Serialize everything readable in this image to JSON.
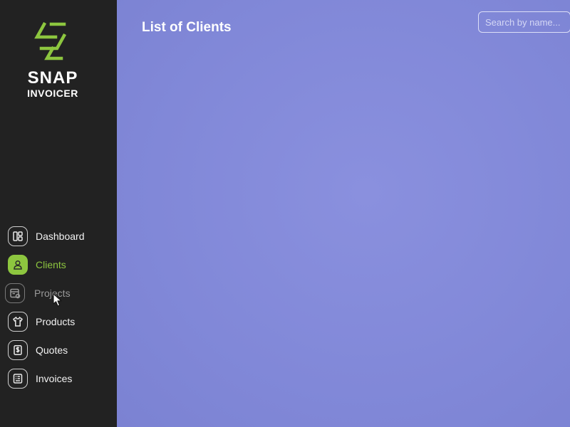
{
  "app": {
    "logo_line1": "SNAP",
    "logo_line2": "INVOICER",
    "accent_color": "#8dc63f",
    "sidebar_color": "#222222",
    "main_color": "#8188d8"
  },
  "header": {
    "title": "List of Clients",
    "search_placeholder": "Search by name..."
  },
  "sidebar": {
    "items": [
      {
        "label": "Dashboard",
        "icon": "dashboard-grid-icon",
        "state": "normal"
      },
      {
        "label": "Clients",
        "icon": "user-icon",
        "state": "active"
      },
      {
        "label": "Projects",
        "icon": "project-calendar-icon",
        "state": "hover"
      },
      {
        "label": "Products",
        "icon": "tshirt-icon",
        "state": "normal"
      },
      {
        "label": "Quotes",
        "icon": "dollar-document-icon",
        "state": "normal"
      },
      {
        "label": "Invoices",
        "icon": "invoice-list-icon",
        "state": "normal"
      }
    ]
  }
}
